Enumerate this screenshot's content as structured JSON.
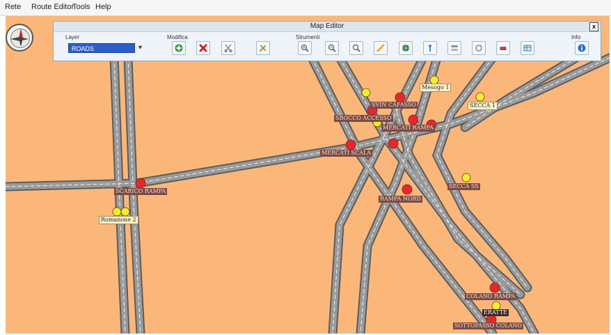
{
  "menu": {
    "items": [
      "Rete",
      "Route Editor",
      "Tools",
      "Help"
    ]
  },
  "editor": {
    "title": "Map Editor",
    "close_label": "x",
    "groups": {
      "layer": "Layer",
      "modifica": "Modifica",
      "strumenti": "Strumenti",
      "info": "Info"
    },
    "layer_value": "ROADS",
    "layer_arrow": "▾"
  },
  "tools": [
    {
      "name": "add-icon",
      "color": "#2e9b3a"
    },
    {
      "name": "delete-icon",
      "color": "#c8202a"
    },
    {
      "name": "scissors-icon",
      "color": "#6d7f90"
    },
    {
      "name": "wrench-icon",
      "color": "#c99a2e"
    },
    {
      "name": "zoom-in-icon",
      "color": "#5b6f84"
    },
    {
      "name": "zoom-out-icon",
      "color": "#5b6f84"
    },
    {
      "name": "zoom-extent-icon",
      "color": "#5b6f84"
    },
    {
      "name": "pencil-icon",
      "color": "#e7b42a"
    },
    {
      "name": "globe-icon",
      "color": "#2f7f4d"
    },
    {
      "name": "pin-icon",
      "color": "#4d84c6"
    },
    {
      "name": "layers-icon",
      "color": "#7f8fa4"
    },
    {
      "name": "refresh-icon",
      "color": "#7f8fa4"
    },
    {
      "name": "eraser-icon",
      "color": "#c94444"
    },
    {
      "name": "table-icon",
      "color": "#3f7fb4"
    },
    {
      "name": "info-icon",
      "color": "#2a6fc8"
    }
  ],
  "map": {
    "labels": {
      "mesogo1": "Mesogo 1",
      "secca1": "SECCA 1",
      "svincolo": "SVIN CAFASSO",
      "sbocco": "SBOCCO ACCESSO",
      "mercati_ramp": "MERCATI RAMPA",
      "mercati_scala": "MERCATI SCALA",
      "scarico": "SCARICO RAMPA",
      "romanone2": "Romanone 2",
      "rampa_nord": "RAMPA NORD",
      "secca_ss": "SECCA SS",
      "colano_rampa": "COLANO RAMPA",
      "eratte": "ERATTE",
      "sottopasso": "SOTTOPASSO COLANO"
    }
  }
}
